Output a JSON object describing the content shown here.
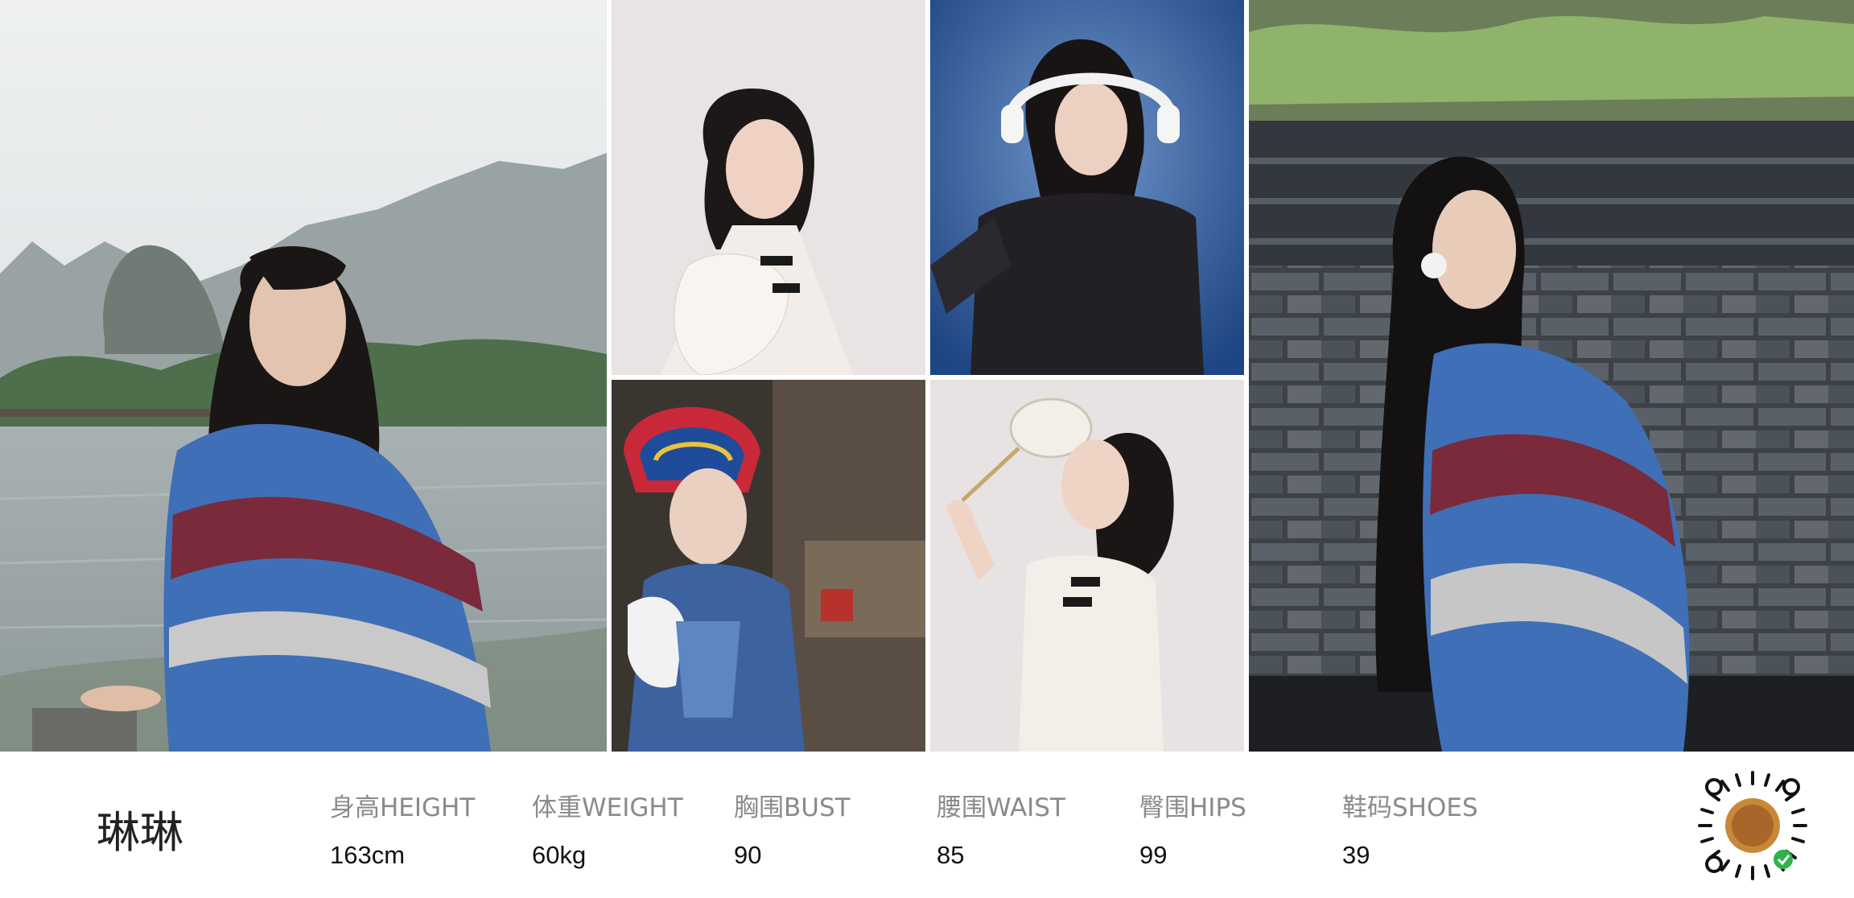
{
  "model": {
    "name": "琳琳"
  },
  "stats": [
    {
      "label": "身高HEIGHT",
      "value": "163cm"
    },
    {
      "label": "体重WEIGHT",
      "value": "60kg"
    },
    {
      "label": "胸围BUST",
      "value": "90"
    },
    {
      "label": "腰围WAIST",
      "value": "85"
    },
    {
      "label": "臀围HIPS",
      "value": "99"
    },
    {
      "label": "鞋码SHOES",
      "value": "39"
    }
  ],
  "colors": {
    "label": "#8a8a8a",
    "value": "#111111",
    "background": "#ffffff",
    "poncho_blue": "#3f6fb6",
    "poncho_red": "#7a2a3a",
    "studio_blue": "#2f5a9a"
  },
  "icons": {
    "mini_program_code": "wechat-mini-program-code-icon"
  }
}
